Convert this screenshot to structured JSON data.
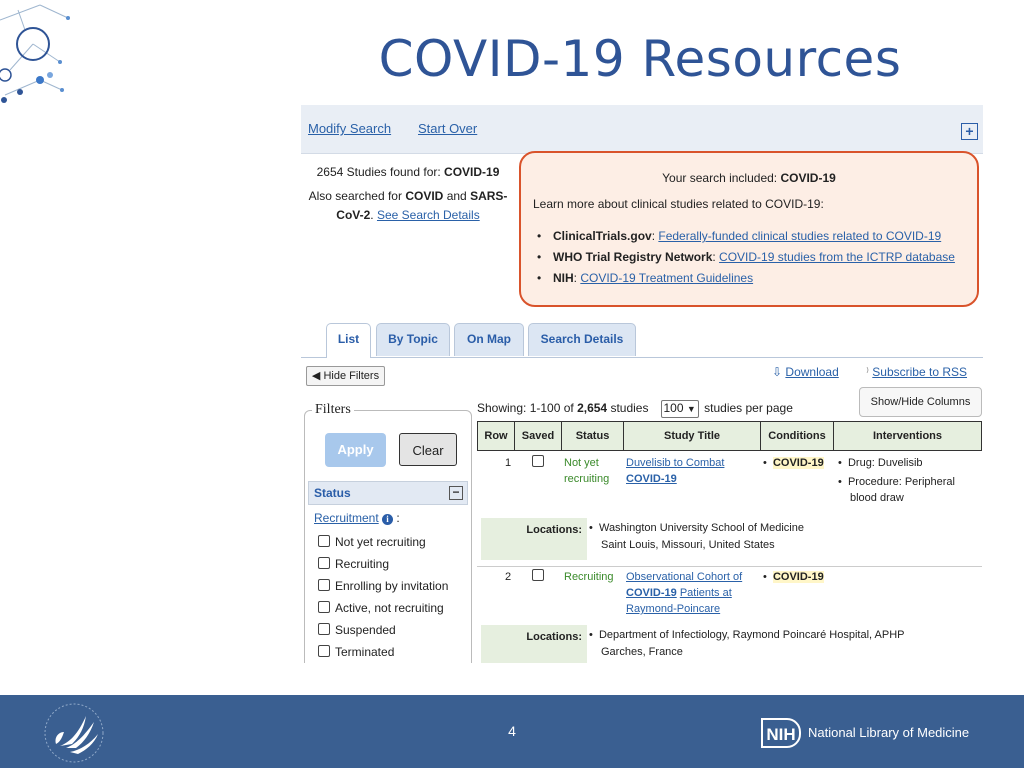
{
  "slide": {
    "title": "COVID-19 Resources",
    "page_number": "4"
  },
  "toolbar": {
    "modify": "Modify Search",
    "start_over": "Start Over",
    "expand_icon": "plus-icon"
  },
  "summary": {
    "count": "2654",
    "found_for": "Studies found for:",
    "term": "COVID-19",
    "also_label": "Also searched for",
    "also_term1": "COVID",
    "and": "and",
    "also_term2": "SARS-CoV-2",
    "see_details": "See Search Details"
  },
  "notice": {
    "included_label": "Your search included:",
    "included_term": "COVID-19",
    "learn": "Learn more about clinical studies related to COVID-19:",
    "links": [
      {
        "source": "ClinicalTrials.gov",
        "text": "Federally-funded clinical studies related to COVID-19"
      },
      {
        "source": "WHO Trial Registry Network",
        "text": "COVID-19 studies from the ICTRP database"
      },
      {
        "source": "NIH",
        "text": "COVID-19 Treatment Guidelines"
      }
    ]
  },
  "tabs": [
    "List",
    "By Topic",
    "On Map",
    "Search Details"
  ],
  "actions": {
    "hide_filters": "Hide Filters",
    "download": "Download",
    "rss": "Subscribe to RSS",
    "show_hide": "Show/Hide Columns"
  },
  "paging": {
    "showing_label": "Showing: 1-100 of",
    "total": "2,654",
    "studies": "studies",
    "per_page_value": "100",
    "per_page_label": "studies per page"
  },
  "filters": {
    "legend": "Filters",
    "apply": "Apply",
    "clear": "Clear",
    "status_header": "Status",
    "recruitment_label": "Recruitment",
    "options": [
      "Not yet recruiting",
      "Recruiting",
      "Enrolling by invitation",
      "Active, not recruiting",
      "Suspended",
      "Terminated"
    ]
  },
  "table": {
    "columns": [
      "Row",
      "Saved",
      "Status",
      "Study Title",
      "Conditions",
      "Interventions"
    ],
    "locations_label": "Locations:",
    "rows": [
      {
        "row": "1",
        "status": "Not yet recruiting",
        "title_a": "Duvelisib to Combat",
        "title_b": "COVID-19",
        "condition": "COVID-19",
        "interventions": [
          "Drug: Duvelisib",
          "Procedure: Peripheral blood draw"
        ],
        "location_name": "Washington University School of Medicine",
        "location_place": "Saint Louis, Missouri, United States"
      },
      {
        "row": "2",
        "status": "Recruiting",
        "title_a": "Observational Cohort of",
        "title_b": "COVID-19",
        "title_c": "Patients at",
        "title_d": "Raymond-Poincare",
        "condition": "COVID-19",
        "location_name": "Department of Infectiology, Raymond Poincaré Hospital, APHP",
        "location_place": "Garches, France"
      }
    ]
  },
  "footer": {
    "nih": "NIH",
    "nlm": "National Library of Medicine"
  }
}
